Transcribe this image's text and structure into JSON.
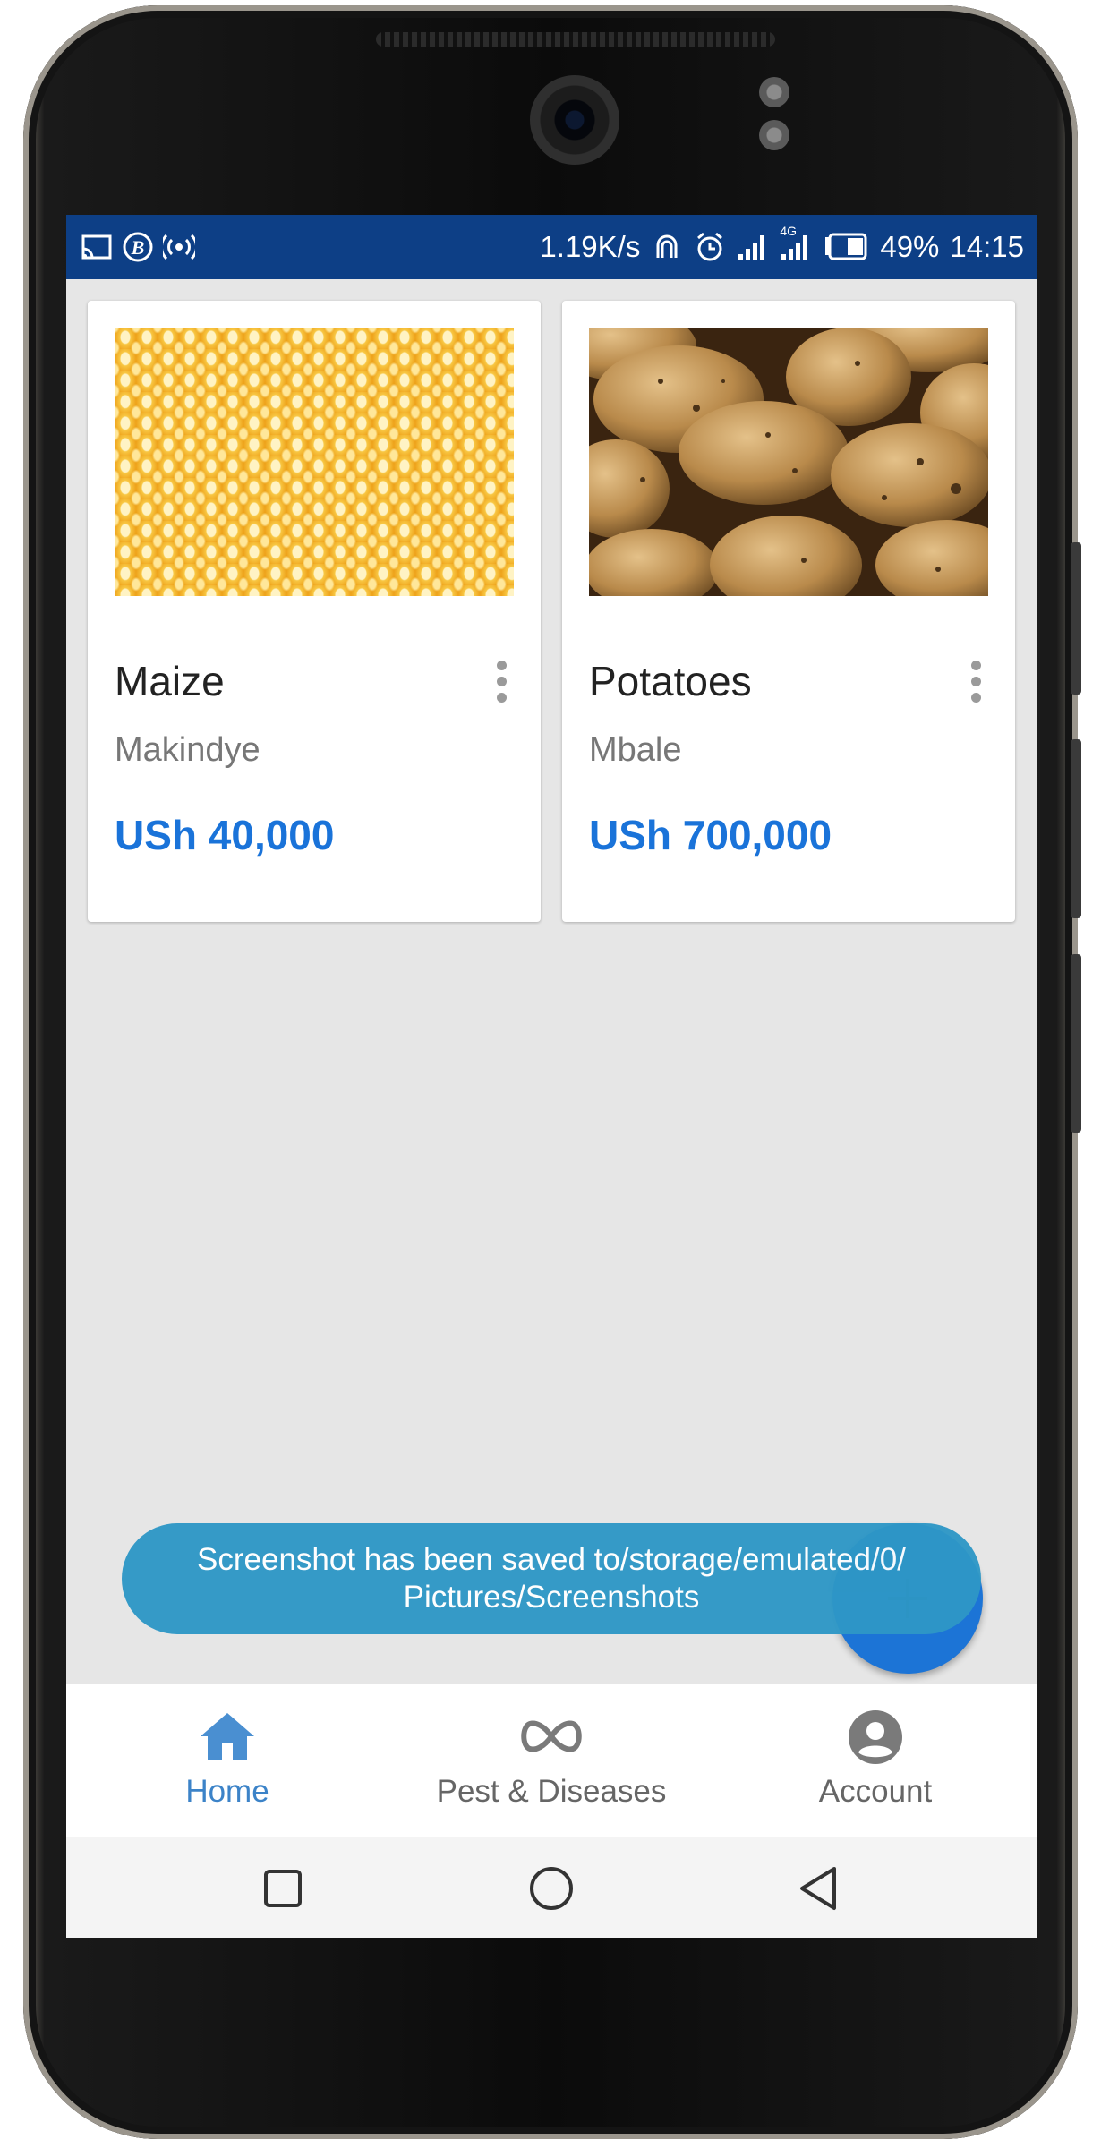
{
  "status_bar": {
    "speed": "1.19K/s",
    "network": "4G",
    "battery": "49%",
    "time": "14:15",
    "left_icons": [
      "screencast-icon",
      "bitcoin-icon",
      "hotspot-icon"
    ],
    "right_icons": [
      "nfc-icon",
      "alarm-icon",
      "signal-icon",
      "signal-4g-icon",
      "battery-icon"
    ]
  },
  "products": [
    {
      "name": "Maize",
      "location": "Makindye",
      "price": "USh 40,000",
      "image": "maize-kernels"
    },
    {
      "name": "Potatoes",
      "location": "Mbale",
      "price": "USh 700,000",
      "image": "potatoes"
    }
  ],
  "toast": {
    "line1": "Screenshot has been saved to/storage/emulated/0/",
    "line2": "Pictures/Screenshots"
  },
  "fab": {
    "icon": "plus-icon"
  },
  "bottom_nav": {
    "items": [
      {
        "label": "Home",
        "icon": "home-icon",
        "active": true
      },
      {
        "label": "Pest & Diseases",
        "icon": "infinity-icon",
        "active": false
      },
      {
        "label": "Account",
        "icon": "account-icon",
        "active": false
      }
    ]
  },
  "system_nav": [
    "recent-apps-icon",
    "home-circle-icon",
    "back-icon"
  ],
  "colors": {
    "status_bar": "#0d3f86",
    "price": "#1a73d9",
    "toast": "#2e97c6",
    "fab": "#1c74d6",
    "nav_active": "#3c83c8",
    "background": "#e6e6e6"
  }
}
